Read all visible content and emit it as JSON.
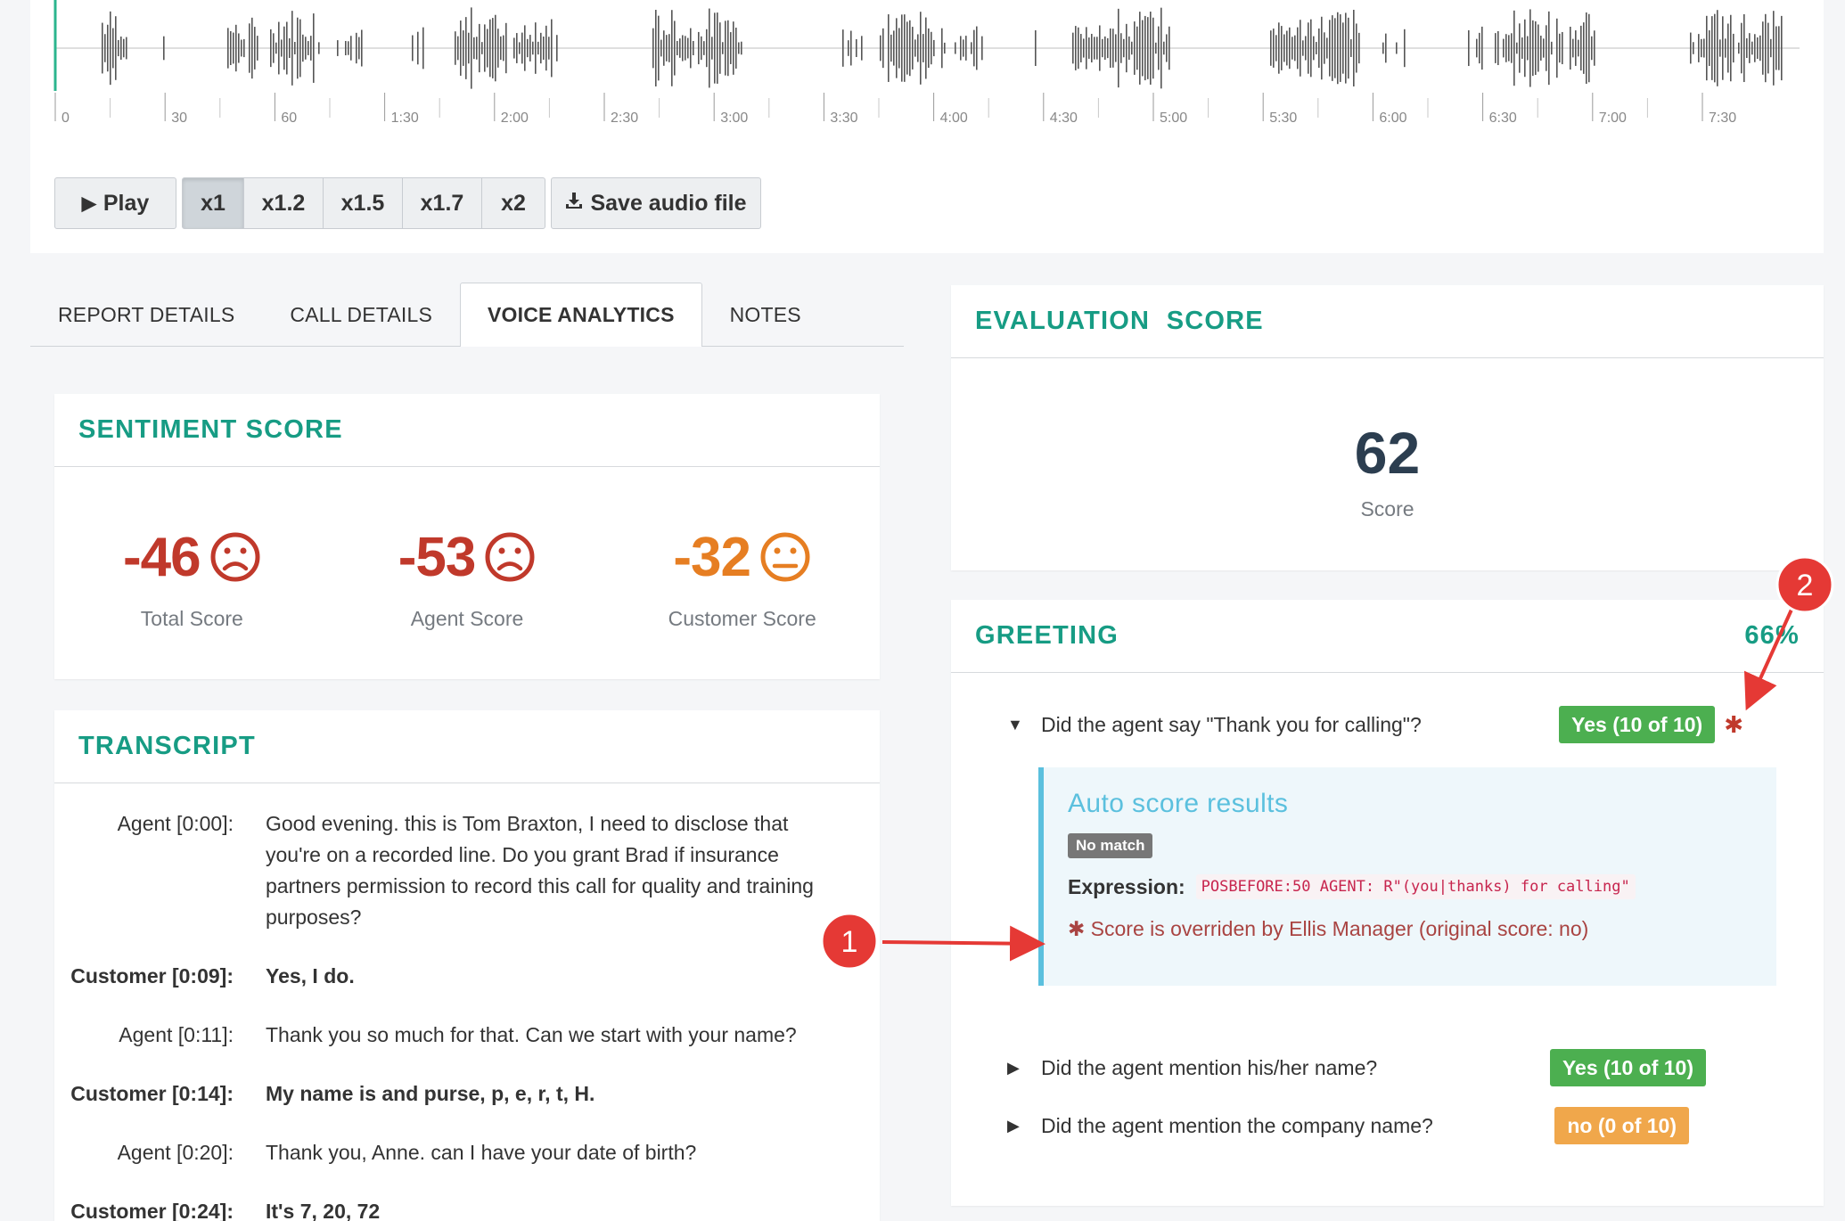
{
  "timeline": {
    "ticks": [
      "0",
      "30",
      "60",
      "1:30",
      "2:00",
      "2:30",
      "3:00",
      "3:30",
      "4:00",
      "4:30",
      "5:00",
      "5:30",
      "6:00",
      "6:30",
      "7:00",
      "7:30"
    ]
  },
  "player": {
    "play_label": "Play",
    "speeds": [
      "x1",
      "x1.2",
      "x1.5",
      "x1.7",
      "x2"
    ],
    "active_speed": "x1",
    "save_label": "Save audio file"
  },
  "tabs": [
    {
      "label": "REPORT DETAILS",
      "active": false
    },
    {
      "label": "CALL DETAILS",
      "active": false
    },
    {
      "label": "VOICE ANALYTICS",
      "active": true
    },
    {
      "label": "NOTES",
      "active": false
    }
  ],
  "sentiment": {
    "title": "SENTIMENT SCORE",
    "scores": [
      {
        "value": "-46",
        "label": "Total Score",
        "mood": "sad",
        "color": "#c0392b"
      },
      {
        "value": "-53",
        "label": "Agent Score",
        "mood": "sad",
        "color": "#c0392b"
      },
      {
        "value": "-32",
        "label": "Customer Score",
        "mood": "neutral",
        "color": "#e67e22"
      }
    ]
  },
  "transcript": {
    "title": "TRANSCRIPT",
    "rows": [
      {
        "speaker": "Agent [0:00]:",
        "text": "Good evening. this is Tom Braxton, I need to disclose that you're on a recorded line. Do you grant Brad if insurance partners permission to record this call for quality and training purposes?",
        "role": "agent"
      },
      {
        "speaker": "Customer [0:09]:",
        "text": "Yes, I do.",
        "role": "customer"
      },
      {
        "speaker": "Agent [0:11]:",
        "text": "Thank you so much for that. Can we start with your name?",
        "role": "agent"
      },
      {
        "speaker": "Customer [0:14]:",
        "text": "My name is and purse, p, e, r, t, H.",
        "role": "customer"
      },
      {
        "speaker": "Agent [0:20]:",
        "text": "Thank you, Anne. can I have your date of birth?",
        "role": "agent"
      },
      {
        "speaker": "Customer [0:24]:",
        "text": "It's 7, 20, 72",
        "role": "customer"
      }
    ]
  },
  "evaluation": {
    "title": "EVALUATION  SCORE",
    "score": "62",
    "score_label": "Score"
  },
  "greeting": {
    "title": "GREETING",
    "percent": "66%",
    "questions": [
      {
        "text": "Did the agent say \"Thank you for calling\"?",
        "badge": "Yes (10 of 10)",
        "badge_color": "#4caf50",
        "expanded": true,
        "overridden": true
      },
      {
        "text": "Did the agent mention his/her name?",
        "badge": "Yes (10 of 10)",
        "badge_color": "#4caf50",
        "expanded": false,
        "overridden": false
      },
      {
        "text": "Did the agent mention the company name?",
        "badge": "no (0 of 10)",
        "badge_color": "#f0a74b",
        "expanded": false,
        "overridden": false
      }
    ],
    "auto_score": {
      "title": "Auto score results",
      "status_badge": "No match",
      "expression_label": "Expression:",
      "expression": "POSBEFORE:50 AGENT: R\"(you|thanks) for calling\"",
      "override_note": "Score is overriden by Ellis Manager (original score: no)"
    }
  },
  "annotations": {
    "callout_1": "1",
    "callout_2": "2",
    "callout_color": "#e53935"
  },
  "icons": {
    "play": "play-icon",
    "save": "download-icon",
    "caret_down": "caret-down-icon",
    "caret_right": "caret-right-icon",
    "asterisk": "asterisk-icon"
  }
}
